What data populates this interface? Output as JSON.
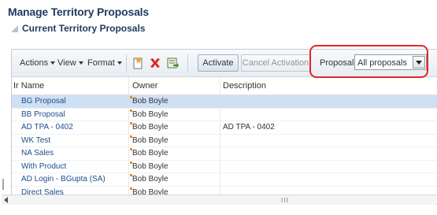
{
  "page_title": "Manage Territory Proposals",
  "section_title": "Current Territory Proposals",
  "toolbar": {
    "actions_label": "Actions",
    "view_label": "View",
    "format_label": "Format",
    "activate_label": "Activate",
    "cancel_activation_label": "Cancel Activation",
    "proposals_label": "Proposals",
    "proposals_selected": "All proposals",
    "icons": [
      "new-document-icon",
      "delete-icon",
      "export-icon"
    ]
  },
  "table": {
    "columns": [
      "Ir Name",
      "Owner",
      "Description"
    ],
    "rows": [
      {
        "name": "BG Proposal",
        "owner": "Bob Boyle",
        "description": "",
        "selected": true
      },
      {
        "name": "BB Proposal",
        "owner": "Bob Boyle",
        "description": ""
      },
      {
        "name": "AD TPA - 0402",
        "owner": "Bob Boyle",
        "description": "AD TPA - 0402"
      },
      {
        "name": "WK Test",
        "owner": "Bob Boyle",
        "description": ""
      },
      {
        "name": "NA Sales",
        "owner": "Bob Boyle",
        "description": ""
      },
      {
        "name": "With Product",
        "owner": "Bob Boyle",
        "description": ""
      },
      {
        "name": "AD Login - BGupta (SA)",
        "owner": "Bob Boyle",
        "description": ""
      },
      {
        "name": "Direct Sales",
        "owner": "Bob Boyle",
        "description": ""
      }
    ]
  },
  "scrollbar_grip": "III",
  "colors": {
    "title": "#1f3a5f",
    "link": "#1c4e8a",
    "selected_row": "#cfe0f3",
    "highlight": "#e3262a"
  }
}
